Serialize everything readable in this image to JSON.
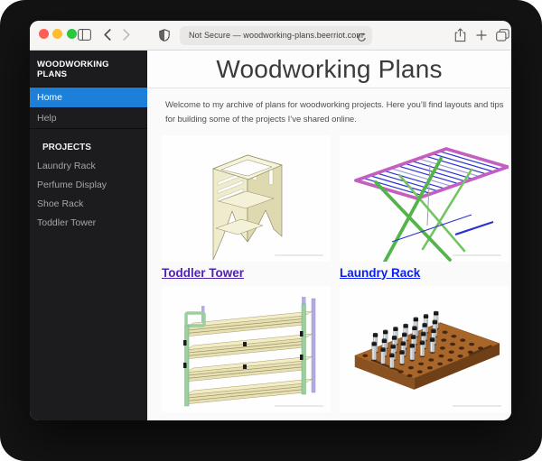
{
  "browser": {
    "url": "Not Secure — woodworking-plans.beerriot.com",
    "traffic_lights": [
      "close",
      "minimize",
      "expand"
    ],
    "toolbar_icons": [
      "sidebar-toggle",
      "back",
      "forward",
      "privacy-shield",
      "reload",
      "share",
      "new-tab",
      "show-tabs"
    ]
  },
  "sidebar": {
    "title": "WOODWORKING PLANS",
    "nav": [
      {
        "label": "Home",
        "active": true
      },
      {
        "label": "Help",
        "active": false
      }
    ],
    "section": "PROJECTS",
    "projects": [
      {
        "label": "Laundry Rack"
      },
      {
        "label": "Perfume Display"
      },
      {
        "label": "Shoe Rack"
      },
      {
        "label": "Toddler Tower"
      }
    ]
  },
  "main": {
    "heading": "Woodworking Plans",
    "intro": "Welcome to my archive of plans for woodworking projects. Here you’ll find layouts and tips for building some of the projects I’ve shared online.",
    "cards": [
      {
        "name": "Toddler Tower",
        "image": "toddler-tower",
        "visited": true
      },
      {
        "name": "Laundry Rack",
        "image": "laundry-rack",
        "visited": false
      },
      {
        "image": "shoe-rack"
      },
      {
        "image": "perfume-display"
      }
    ]
  },
  "colors": {
    "sidebar_bg": "#1c1c1e",
    "active_nav_blue": "#1d80d8",
    "link_unvisited": "#0b21ee",
    "link_visited": "#4f23ad",
    "traffic_red": "#ff5f57",
    "traffic_yellow": "#febc2e",
    "traffic_green": "#29c83f"
  }
}
